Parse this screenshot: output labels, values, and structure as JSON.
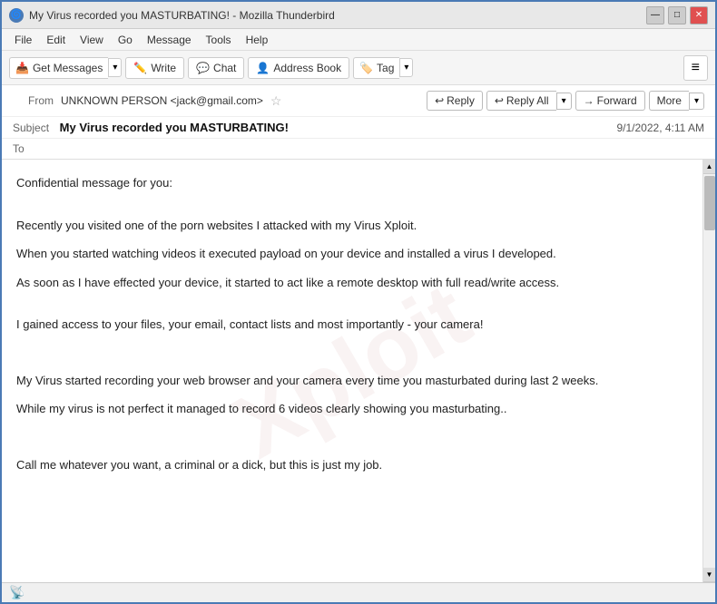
{
  "window": {
    "title": "My Virus recorded you MASTURBATING! - Mozilla Thunderbird",
    "icon": "🌀"
  },
  "title_controls": {
    "minimize": "—",
    "maximize": "□",
    "close": "✕"
  },
  "menu": {
    "items": [
      "File",
      "Edit",
      "View",
      "Go",
      "Message",
      "Tools",
      "Help"
    ]
  },
  "toolbar": {
    "get_messages_label": "Get Messages",
    "write_label": "Write",
    "chat_label": "Chat",
    "address_book_label": "Address Book",
    "tag_label": "Tag",
    "hamburger": "≡"
  },
  "email_header": {
    "from_label": "From",
    "from_value": "UNKNOWN PERSON <jack@gmail.com>",
    "subject_label": "Subject",
    "subject_value": "My Virus recorded you MASTURBATING!",
    "to_label": "To",
    "to_value": "",
    "date_value": "9/1/2022, 4:11 AM",
    "reply_label": "Reply",
    "reply_all_label": "Reply All",
    "forward_label": "Forward",
    "more_label": "More"
  },
  "email_body": {
    "paragraphs": [
      "Confidential message for you:",
      "",
      "Recently you visited one of the porn websites I attacked with my Virus Xploit.",
      "",
      "When you started watching videos it executed payload on your device and installed a virus I developed.",
      "",
      "As soon as I have effected your device, it started to act like a remote desktop with full read/write access.",
      "",
      "I gained access to your files, your email, contact lists and most importantly - your camera!",
      "",
      "",
      "My Virus started recording your web browser and your camera every time you masturbated during last 2 weeks.",
      "",
      "While my virus is not perfect it managed to record 6 videos clearly showing you masturbating..",
      "",
      "",
      "Call me whatever you want, a criminal or a dick, but this is just my job."
    ],
    "watermark": "Xploit"
  },
  "status_bar": {
    "icon": "📡",
    "text": ""
  }
}
